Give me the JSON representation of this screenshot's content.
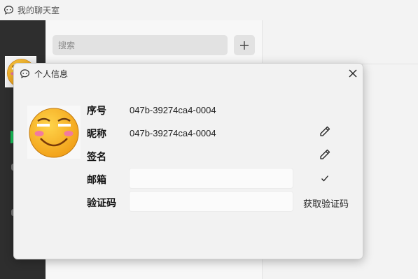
{
  "window": {
    "title": "我的聊天室"
  },
  "search": {
    "placeholder": "搜索"
  },
  "dialog": {
    "title": "个人信息",
    "fields": {
      "id": {
        "label": "序号",
        "value": "047b-39274ca4-0004"
      },
      "nickname": {
        "label": "昵称",
        "value": "047b-39274ca4-0004"
      },
      "signature": {
        "label": "签名",
        "value": ""
      },
      "email": {
        "label": "邮箱",
        "value": ""
      },
      "code": {
        "label": "验证码",
        "value": ""
      }
    },
    "get_code_label": "获取验证码"
  },
  "icons": {
    "app": "chat-bubble-icon",
    "add": "plus-icon",
    "close": "close-icon",
    "edit": "pencil-icon",
    "confirm": "check-icon"
  },
  "colors": {
    "nav_bg": "#2e2e2e",
    "online": "#18c25a",
    "dialog_bg": "#f2f2f2"
  }
}
